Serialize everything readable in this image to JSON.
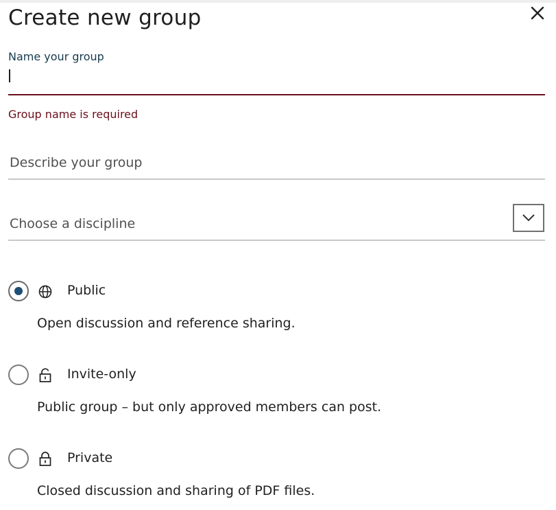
{
  "dialog": {
    "title": "Create new group",
    "close_icon": "close-icon"
  },
  "name_field": {
    "label": "Name your group",
    "value": "",
    "error": "Group name is required"
  },
  "description_field": {
    "placeholder": "Describe your group"
  },
  "discipline_field": {
    "placeholder": "Choose a discipline",
    "icon": "chevron-down-icon"
  },
  "privacy_options": [
    {
      "label": "Public",
      "description": "Open discussion and reference sharing.",
      "icon": "globe-icon",
      "selected": true
    },
    {
      "label": "Invite-only",
      "description": "Public group – but only approved members can post.",
      "icon": "unlocked-lock-icon",
      "selected": false
    },
    {
      "label": "Private",
      "description": "Closed discussion and sharing of PDF files.",
      "icon": "lock-icon",
      "selected": false
    }
  ],
  "colors": {
    "error": "#6b0f1a",
    "label": "#173a4e",
    "radio_selected": "#1d4e75",
    "divider": "#c8c8c8"
  }
}
